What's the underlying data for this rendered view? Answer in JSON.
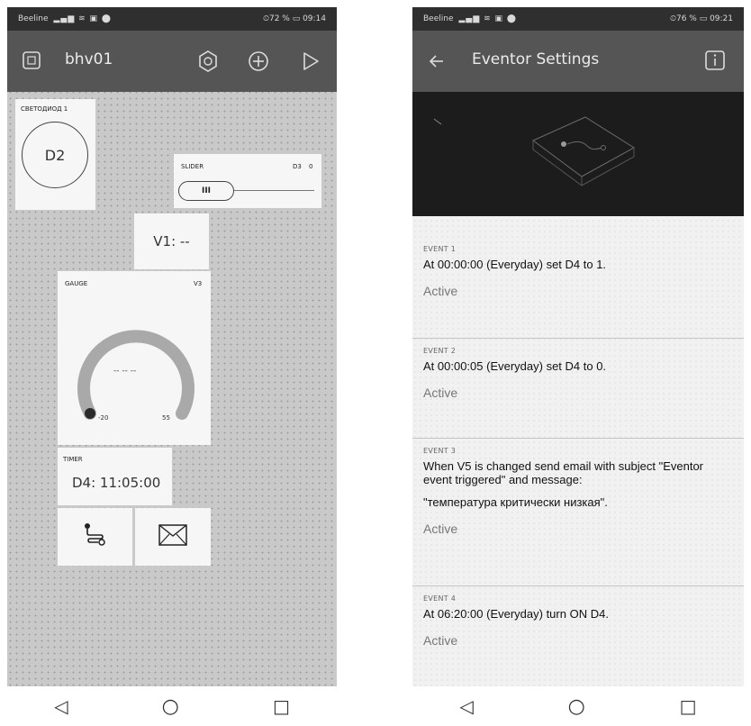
{
  "left": {
    "status": {
      "carrier": "Beeline",
      "signal": "▂▄▆ ≋ ▣ ⬤",
      "right": "⏲72 % ▭ 09:14"
    },
    "app_bar": {
      "title": "bhv01"
    },
    "widgets": {
      "led": {
        "label": "СВЕТОДИОД 1",
        "button": "D2"
      },
      "slider": {
        "label": "SLIDER",
        "pin": "D3",
        "value": "0",
        "handle": "III"
      },
      "display": {
        "text": "V1: --"
      },
      "gauge": {
        "label": "GAUGE",
        "pin": "V3",
        "value": "-- -- --",
        "min": "-20",
        "max": "55"
      },
      "timer": {
        "label": "TIMER",
        "text": "D4: 11:05:00"
      }
    },
    "icons": [
      "eventor-icon",
      "mail-icon"
    ]
  },
  "right": {
    "status": {
      "carrier": "Beeline",
      "signal": "▂▄▆ ≋ ▣ ⬤",
      "right": "⏲76 % ▭ 09:21"
    },
    "app_bar": {
      "title": "Eventor Settings"
    },
    "events": [
      {
        "label": "EVENT 1",
        "desc": "At 00:00:00 (Everyday) set D4 to 1.",
        "extra": "",
        "status": "Active"
      },
      {
        "label": "EVENT 2",
        "desc": "At 00:00:05 (Everyday) set D4 to 0.",
        "extra": "",
        "status": "Active"
      },
      {
        "label": "EVENT 3",
        "desc": "When V5 is changed send email with subject \"Eventor event triggered\" and message:",
        "extra": "\"температура критически низкая\".",
        "status": "Active"
      },
      {
        "label": "EVENT 4",
        "desc": "At 06:20:00 (Everyday) turn ON D4.",
        "extra": "",
        "status": "Active"
      }
    ]
  },
  "nav": {
    "back": "◁",
    "home": "○",
    "recents": "□"
  },
  "colors": {
    "app_bar": "#555555",
    "status_bar": "#2f2f2f",
    "canvas": "#c9c9c9",
    "hero": "#1c1c1c"
  }
}
